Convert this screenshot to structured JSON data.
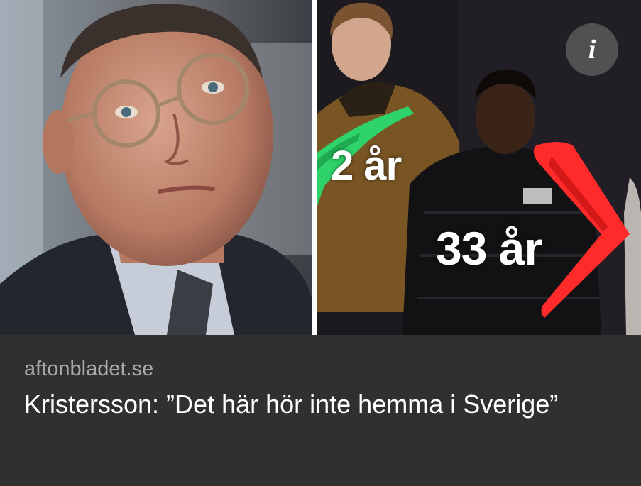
{
  "card": {
    "source": "aftonbladet.se",
    "headline": "Kristersson: ”Det här hör inte hemma i Sverige”"
  },
  "images": {
    "left": {
      "subject": "man-with-glasses-portrait"
    },
    "right": {
      "subject": "two-young-people-at-night",
      "age_label_left": "2 år",
      "age_label_right": "33 år"
    }
  },
  "info_button": {
    "icon": "info-icon",
    "glyph": "i"
  },
  "colors": {
    "background": "#303030",
    "source_text": "#a9a9a9",
    "headline_text": "#ffffff",
    "green_arrow": "#2fd36b",
    "red_arrow": "#ff2b2b"
  }
}
